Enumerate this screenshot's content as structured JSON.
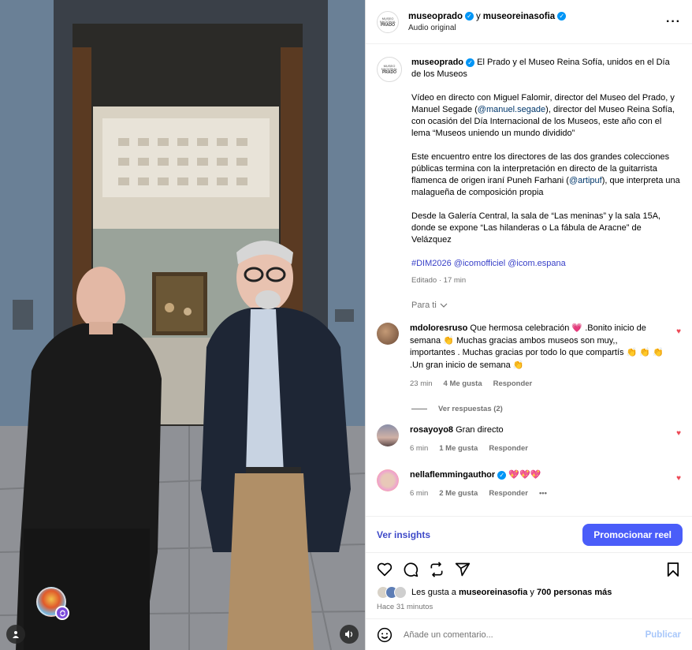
{
  "header": {
    "author1": "museoprado",
    "connector": "y",
    "author2": "museoreinasofia",
    "audio": "Audio original",
    "more_icon": "more-horizontal-icon"
  },
  "caption": {
    "username": "museoprado",
    "title": "El Prado y el Museo Reina Sofía, unidos en el Día de los Museos",
    "p1_a": "Vídeo en directo con Miguel Falomir, director del Museo del Prado, y Manuel Segade (",
    "p1_link": "@manuel.segade",
    "p1_b": "), director del Museo Reina Sofía, con ocasión del Día Internacional de los Museos, este año con el lema “Museos uniendo un mundo dividido”",
    "p2_a": "Este encuentro entre los directores de las dos grandes colecciones públicas termina con la interpretación en directo de la guitarrista flamenca de origen iraní Puneh Farhani (",
    "p2_link": "@artipuf",
    "p2_b": "), que interpreta una malagueña de composición propia",
    "p3": "Desde la Galería Central, la sala de “Las meninas” y la sala 15A, donde se expone “Las hilanderas o La fábula de Aracne” de Velázquez",
    "tags": "#DIM2026 @icomofficiel @icom.espana",
    "edited": "Editado · 17 min"
  },
  "para_ti": "Para ti",
  "comments": [
    {
      "username": "mdoloresruso",
      "text": "Que hermosa celebración 💗 .Bonito inicio de semana 👏 Muchas gracias ambos museos son muy,, importantes . Muchas gracias por todo lo que compartís 👏 👏 👏 .Un gran inicio de semana 👏",
      "time": "23 min",
      "likes": "4 Me gusta",
      "reply": "Responder",
      "view_replies": "Ver respuestas (2)"
    },
    {
      "username": "rosayoyo8",
      "text": "Gran directo",
      "time": "6 min",
      "likes": "1 Me gusta",
      "reply": "Responder"
    },
    {
      "username": "nellaflemmingauthor",
      "text": "💖💖💖",
      "time": "6 min",
      "likes": "2 Me gusta",
      "reply": "Responder",
      "more": "•••"
    }
  ],
  "insights": {
    "link": "Ver insights",
    "promote": "Promocionar reel"
  },
  "likes": {
    "prefix": "Les gusta a",
    "user": "museoreinasofia",
    "middle": "y",
    "count": "700 personas más"
  },
  "time_ago": "Hace 31 minutos",
  "comment_box": {
    "placeholder": "Añade un comentario...",
    "publish": "Publicar"
  },
  "colors": {
    "accent": "#4a5df9",
    "link": "#00376b",
    "heart": "#ed4956",
    "verified": "#0095f6"
  }
}
